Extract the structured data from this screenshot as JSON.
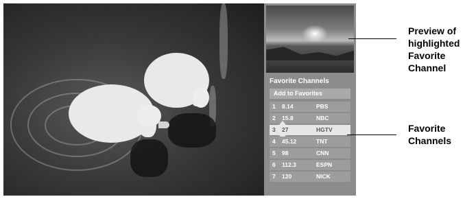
{
  "panel": {
    "title": "Favorite Channels",
    "add_button": "Add to Favorites",
    "channels": [
      {
        "num": "1",
        "channel": "8.14",
        "network": "PBS"
      },
      {
        "num": "2",
        "channel": "15.8",
        "network": "NBC"
      },
      {
        "num": "3",
        "channel": "27",
        "network": "HGTV"
      },
      {
        "num": "4",
        "channel": "45.12",
        "network": "TNT"
      },
      {
        "num": "5",
        "channel": "98",
        "network": "CNN"
      },
      {
        "num": "6",
        "channel": "112.3",
        "network": "ESPN"
      },
      {
        "num": "7",
        "channel": "120",
        "network": "NICK"
      }
    ],
    "highlighted_index": 2
  },
  "callouts": {
    "preview_l1": "Preview of",
    "preview_l2": "highlighted",
    "preview_l3": "Favorite",
    "preview_l4": "Channel",
    "favorites_l1": "Favorite",
    "favorites_l2": "Channels"
  }
}
